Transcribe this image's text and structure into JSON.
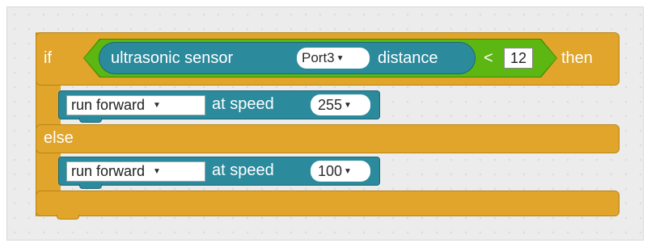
{
  "if_block": {
    "if_label": "if",
    "then_label": "then",
    "else_label": "else",
    "condition": {
      "sensor_label": "ultrasonic sensor",
      "port_value": "Port3",
      "distance_label": "distance",
      "operator": "<",
      "compare_value": "12"
    }
  },
  "then_branch": {
    "action_value": "run forward",
    "at_speed_label": "at speed",
    "speed_value": "255"
  },
  "else_branch": {
    "action_value": "run forward",
    "at_speed_label": "at speed",
    "speed_value": "100"
  },
  "colors": {
    "control": "#e0a52a",
    "operator": "#5cb712",
    "robot": "#2c8a9d"
  }
}
